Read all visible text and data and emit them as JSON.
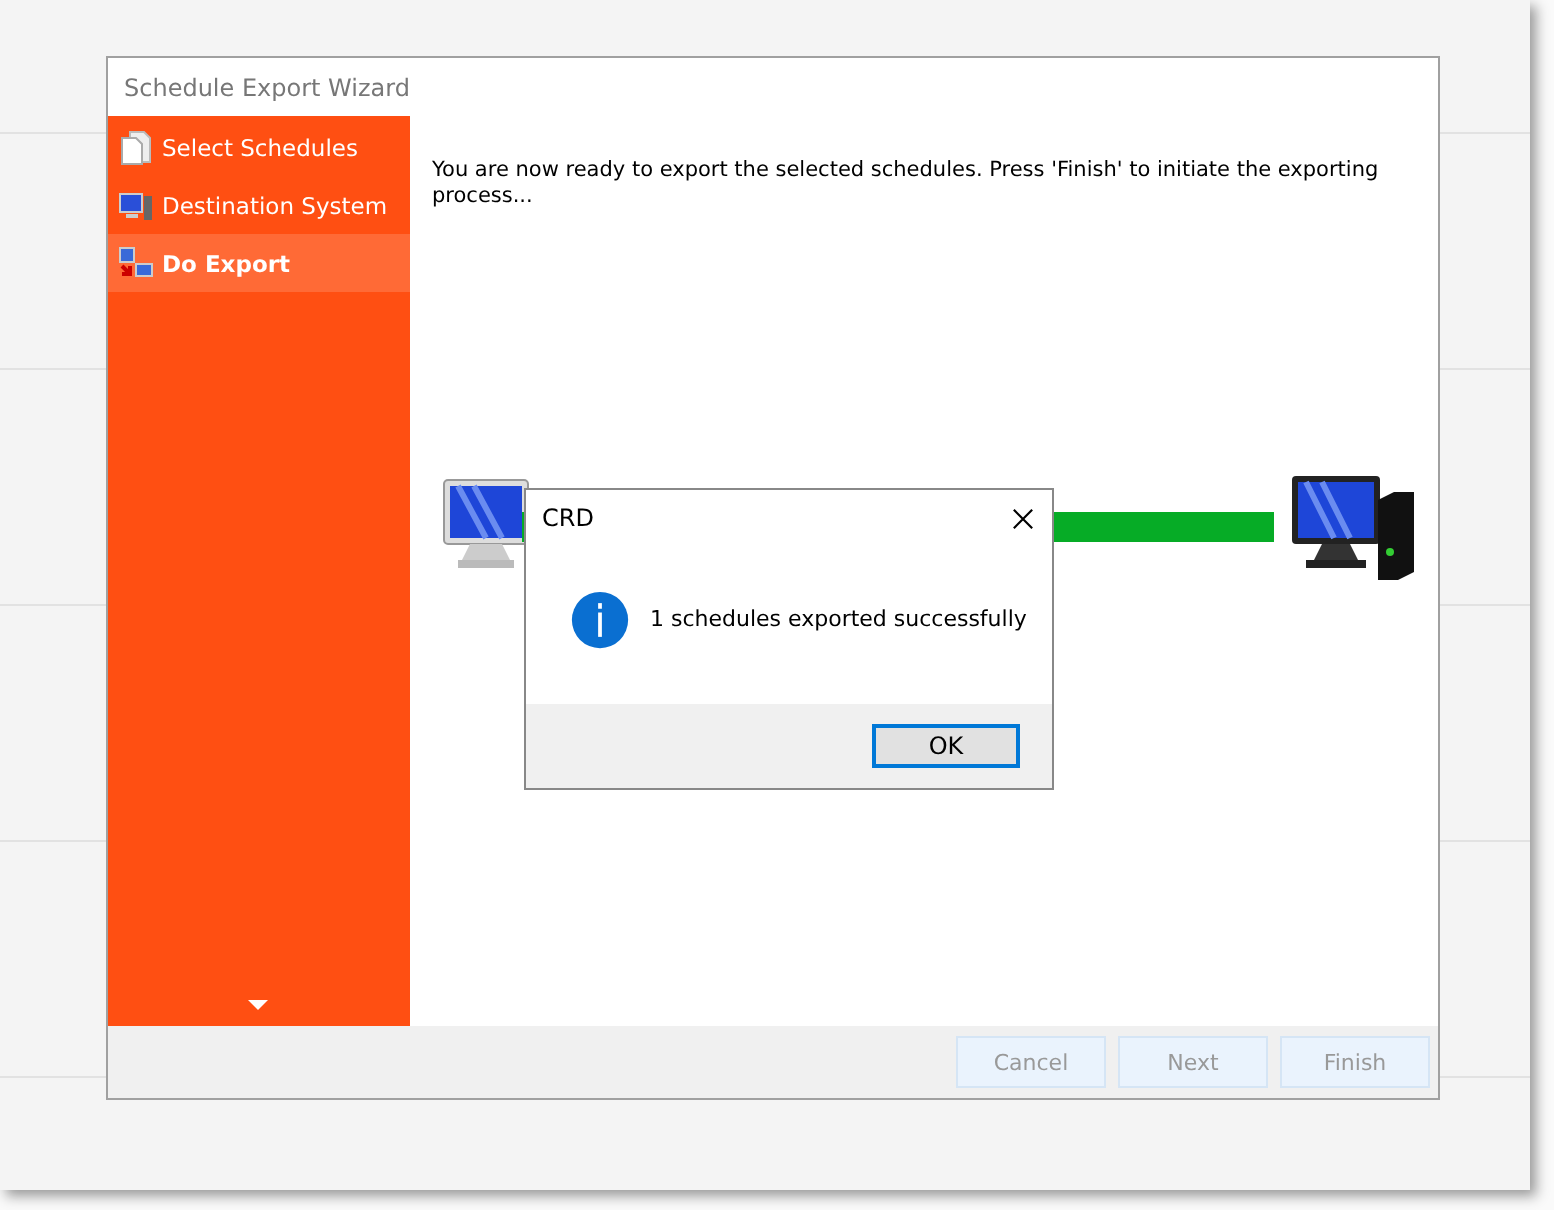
{
  "window": {
    "title": "Schedule Export Wizard"
  },
  "sidebar": {
    "items": [
      {
        "label": "Select Schedules",
        "kind": "pages",
        "selected": false
      },
      {
        "label": "Destination System",
        "kind": "computer",
        "selected": false
      },
      {
        "label": "Do Export",
        "kind": "export",
        "selected": true
      }
    ]
  },
  "content": {
    "message": "You are now ready to export the selected schedules. Press 'Finish' to initiate the exporting process...",
    "progress": {
      "level": 1
    }
  },
  "buttons": [
    {
      "label": "Cancel",
      "disabled": true
    },
    {
      "label": "Next",
      "disabled": true
    },
    {
      "label": "Finish",
      "disabled": true
    }
  ],
  "dialog": {
    "title": "CRD",
    "message": "1 schedules exported successfully",
    "buttons": [
      {
        "label": "OK",
        "default": true
      }
    ]
  }
}
